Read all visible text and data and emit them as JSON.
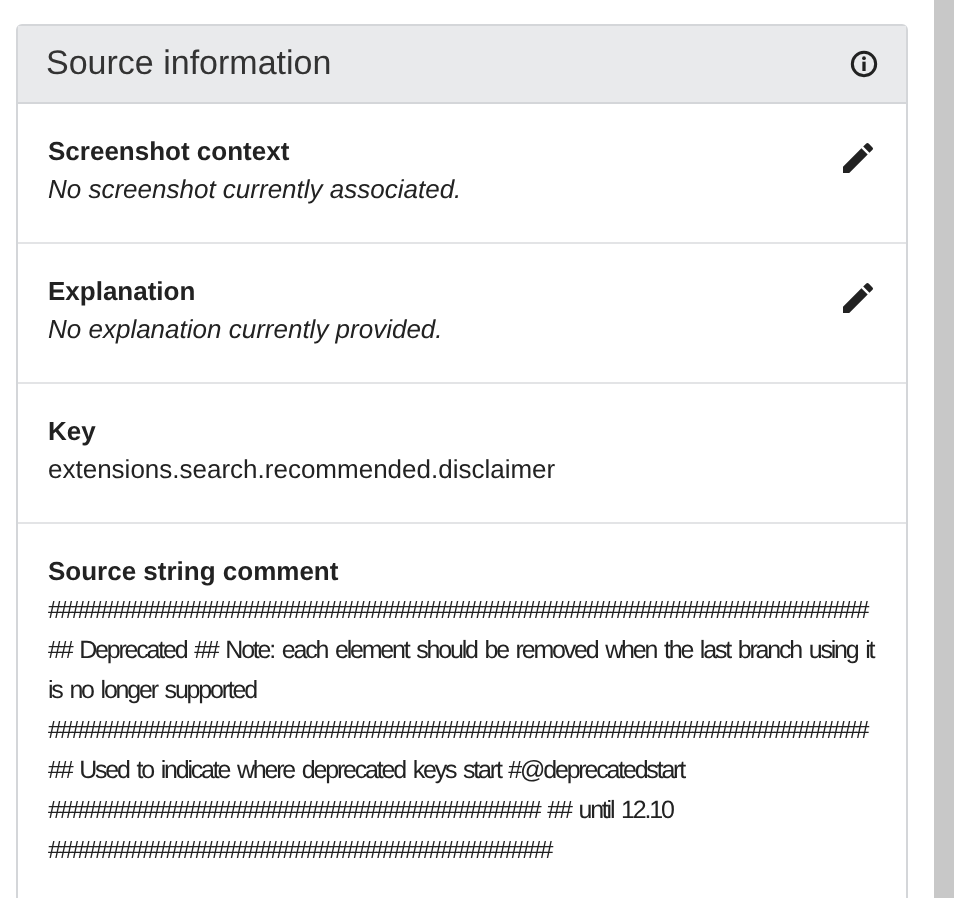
{
  "panel": {
    "title": "Source information",
    "sections": [
      {
        "kind": "editable",
        "label": "Screenshot context",
        "value": "No screenshot currently associated.",
        "empty": true
      },
      {
        "kind": "editable",
        "label": "Explanation",
        "value": "No explanation currently provided.",
        "empty": true
      },
      {
        "kind": "plain",
        "label": "Key",
        "value": "extensions.search.recommended.disclaimer",
        "empty": false
      },
      {
        "kind": "plain",
        "label": "Source string comment",
        "value": "###################################################################### ## Deprecated ## Note: each element should be removed when the last branch using it is no longer supported ###################################################################### ## Used to indicate where deprecated keys start #@deprecatedstart ########################################## ## until 12.10 ###########################################",
        "empty": false
      }
    ]
  }
}
